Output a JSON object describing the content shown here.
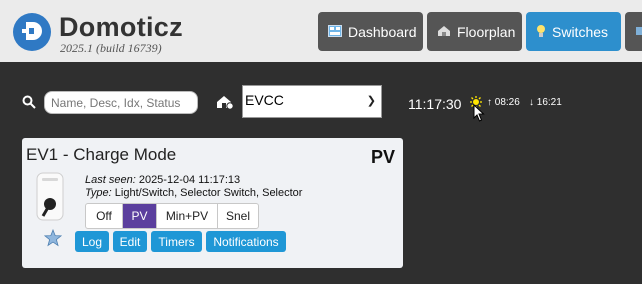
{
  "app": {
    "brand": "Domoticz",
    "version": "2025.1 (build 16739)"
  },
  "nav": [
    {
      "label": "Dashboard",
      "icon": "dashboard-icon",
      "active": false
    },
    {
      "label": "Floorplan",
      "icon": "floorplan-icon",
      "active": false
    },
    {
      "label": "Switches",
      "icon": "lightbulb-icon",
      "active": true
    }
  ],
  "search": {
    "placeholder": "Name, Desc, Idx, Status",
    "value": ""
  },
  "room_select": {
    "selected": "EVCC"
  },
  "time": {
    "clock": "11:17:30",
    "sunrise": "08:26",
    "sunset": "16:21"
  },
  "device": {
    "name": "EV1 - Charge Mode",
    "status": "PV",
    "last_seen_label": "Last seen:",
    "last_seen_value": "2025-12-04 11:17:13",
    "type_label": "Type:",
    "type_value": "Light/Switch, Selector Switch, Selector",
    "levels": [
      "Off",
      "PV",
      "Min+PV",
      "Snel"
    ],
    "active_level": "PV",
    "actions": [
      "Log",
      "Edit",
      "Timers",
      "Notifications"
    ]
  },
  "colors": {
    "header_bg": "#ebebeb",
    "page_bg": "#2f2f2f",
    "nav_button": "#555555",
    "nav_active": "#2d8fcd",
    "selector_active": "#5b3f9e",
    "action_button": "#1f97d6"
  }
}
